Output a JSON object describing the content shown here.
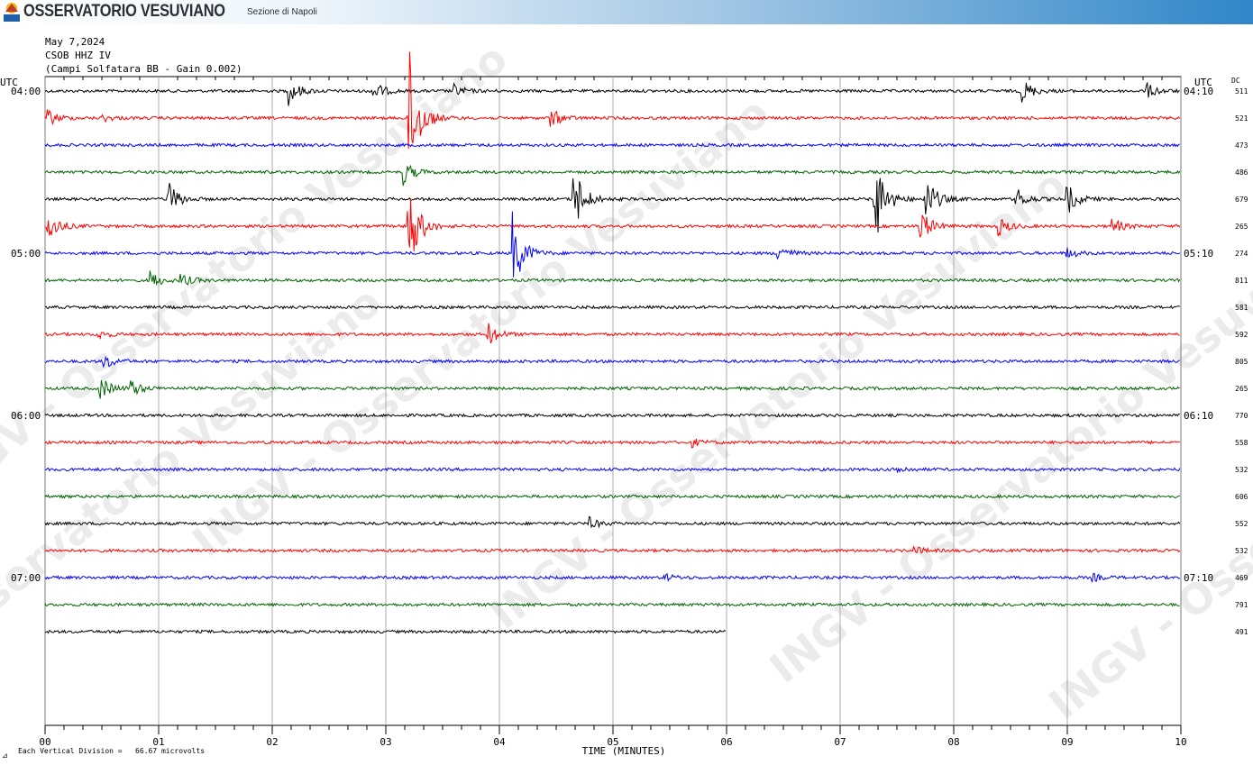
{
  "header": {
    "logo_text": "INGV",
    "title": "OSSERVATORIO VESUVIANO",
    "subtitle": "Sezione di Napoli"
  },
  "info": {
    "date": "May 7,2024",
    "station": "CSOB HHZ IV",
    "description": "(Campi Solfatara BB - Gain 0.002)"
  },
  "watermark": "INGV - Osservatorio Vesuviano",
  "footer": {
    "scale_note": "Each Vertical Division =   66.67 microvolts"
  },
  "colors": {
    "trace_cycle": [
      "#000000",
      "#ff0000",
      "#0000ff",
      "#006400"
    ]
  },
  "chart_data": {
    "type": "seismogram",
    "title": "",
    "xlabel": "TIME (MINUTES)",
    "x_range": [
      0,
      10
    ],
    "x_ticks": [
      "00",
      "01",
      "02",
      "03",
      "04",
      "05",
      "06",
      "07",
      "08",
      "09",
      "10"
    ],
    "left_axis_label": "UTC",
    "right_axis_label": "UTC",
    "dc_header": "DC",
    "minutes_per_line": 10,
    "left_hour_labels": [
      {
        "line": 0,
        "text": "04:00"
      },
      {
        "line": 6,
        "text": "05:00"
      },
      {
        "line": 12,
        "text": "06:00"
      },
      {
        "line": 18,
        "text": "07:00"
      }
    ],
    "right_hour_labels": [
      {
        "line": 0,
        "text": "04:10"
      },
      {
        "line": 6,
        "text": "05:10"
      },
      {
        "line": 12,
        "text": "06:10"
      },
      {
        "line": 18,
        "text": "07:10"
      }
    ],
    "dc_values": [
      "511",
      "521",
      "473",
      "486",
      "679",
      "265",
      "274",
      "811",
      "581",
      "592",
      "805",
      "265",
      "770",
      "558",
      "532",
      "606",
      "552",
      "532",
      "469",
      "791",
      "491"
    ],
    "last_line_end_minute": 6.0,
    "events": [
      {
        "line": 0,
        "minute": 2.15,
        "amp": 1.0
      },
      {
        "line": 0,
        "minute": 2.88,
        "amp": 0.9
      },
      {
        "line": 0,
        "minute": 3.6,
        "amp": 0.5
      },
      {
        "line": 0,
        "minute": 8.6,
        "amp": 1.0
      },
      {
        "line": 0,
        "minute": 9.7,
        "amp": 0.6
      },
      {
        "line": 1,
        "minute": 0.02,
        "amp": 0.7
      },
      {
        "line": 1,
        "minute": 0.5,
        "amp": 0.3
      },
      {
        "line": 1,
        "minute": 3.2,
        "amp": 6.0
      },
      {
        "line": 1,
        "minute": 4.45,
        "amp": 0.8
      },
      {
        "line": 3,
        "minute": 3.15,
        "amp": 1.0
      },
      {
        "line": 4,
        "minute": 1.08,
        "amp": 1.5
      },
      {
        "line": 4,
        "minute": 4.65,
        "amp": 3.0
      },
      {
        "line": 4,
        "minute": 7.3,
        "amp": 4.0
      },
      {
        "line": 4,
        "minute": 7.75,
        "amp": 2.0
      },
      {
        "line": 4,
        "minute": 8.55,
        "amp": 0.9
      },
      {
        "line": 4,
        "minute": 9.0,
        "amp": 1.2
      },
      {
        "line": 5,
        "minute": 0.02,
        "amp": 1.5
      },
      {
        "line": 5,
        "minute": 3.2,
        "amp": 4.0
      },
      {
        "line": 5,
        "minute": 7.7,
        "amp": 1.5
      },
      {
        "line": 5,
        "minute": 8.4,
        "amp": 0.7
      },
      {
        "line": 5,
        "minute": 9.4,
        "amp": 0.6
      },
      {
        "line": 6,
        "minute": 4.12,
        "amp": 3.0
      },
      {
        "line": 6,
        "minute": 6.45,
        "amp": 0.8
      },
      {
        "line": 6,
        "minute": 9.0,
        "amp": 0.4
      },
      {
        "line": 7,
        "minute": 0.92,
        "amp": 0.8
      },
      {
        "line": 7,
        "minute": 1.2,
        "amp": 0.5
      },
      {
        "line": 9,
        "minute": 3.9,
        "amp": 0.9
      },
      {
        "line": 9,
        "minute": 0.45,
        "amp": 0.4
      },
      {
        "line": 10,
        "minute": 0.52,
        "amp": 0.6
      },
      {
        "line": 11,
        "minute": 0.48,
        "amp": 1.0
      },
      {
        "line": 11,
        "minute": 0.75,
        "amp": 0.7
      },
      {
        "line": 13,
        "minute": 5.7,
        "amp": 0.3
      },
      {
        "line": 14,
        "minute": 7.5,
        "amp": 0.3
      },
      {
        "line": 16,
        "minute": 4.8,
        "amp": 0.4
      },
      {
        "line": 17,
        "minute": 7.65,
        "amp": 0.3
      },
      {
        "line": 18,
        "minute": 5.45,
        "amp": 0.3
      },
      {
        "line": 18,
        "minute": 9.22,
        "amp": 0.3
      }
    ],
    "grid": true
  }
}
